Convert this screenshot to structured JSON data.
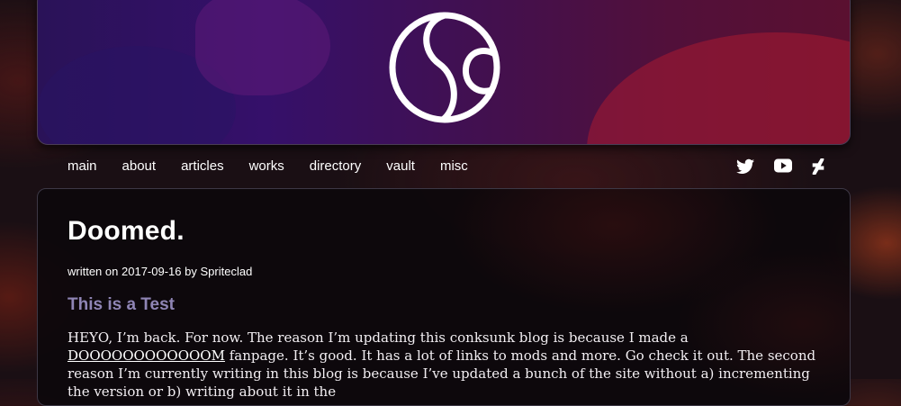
{
  "nav": {
    "items": [
      "main",
      "about",
      "articles",
      "works",
      "directory",
      "vault",
      "misc"
    ]
  },
  "social": {
    "icons": [
      "twitter-icon",
      "youtube-icon",
      "deviantart-icon"
    ]
  },
  "colors": {
    "subheading": "#8f85b5",
    "header_gradient_start": "#2a1258",
    "header_gradient_end": "#5a1030"
  },
  "post": {
    "title": "Doomed.",
    "byline_prefix": "written on",
    "date": "2017-09-16",
    "byline_by": "by",
    "author": "Spriteclad",
    "subheading": "This is a Test",
    "body_start": "HEYO, I’m back. For now. The reason I’m updating this conksunk blog is because I made a ",
    "link_text": "DOOOOOOOOOOOOM",
    "body_end": " fanpage. It’s good. It has a lot of links to mods and more. Go check it out. The second reason I’m currently writing in this blog is because I’ve updated a bunch of the site without a) incrementing the version or b) writing about it in the"
  }
}
